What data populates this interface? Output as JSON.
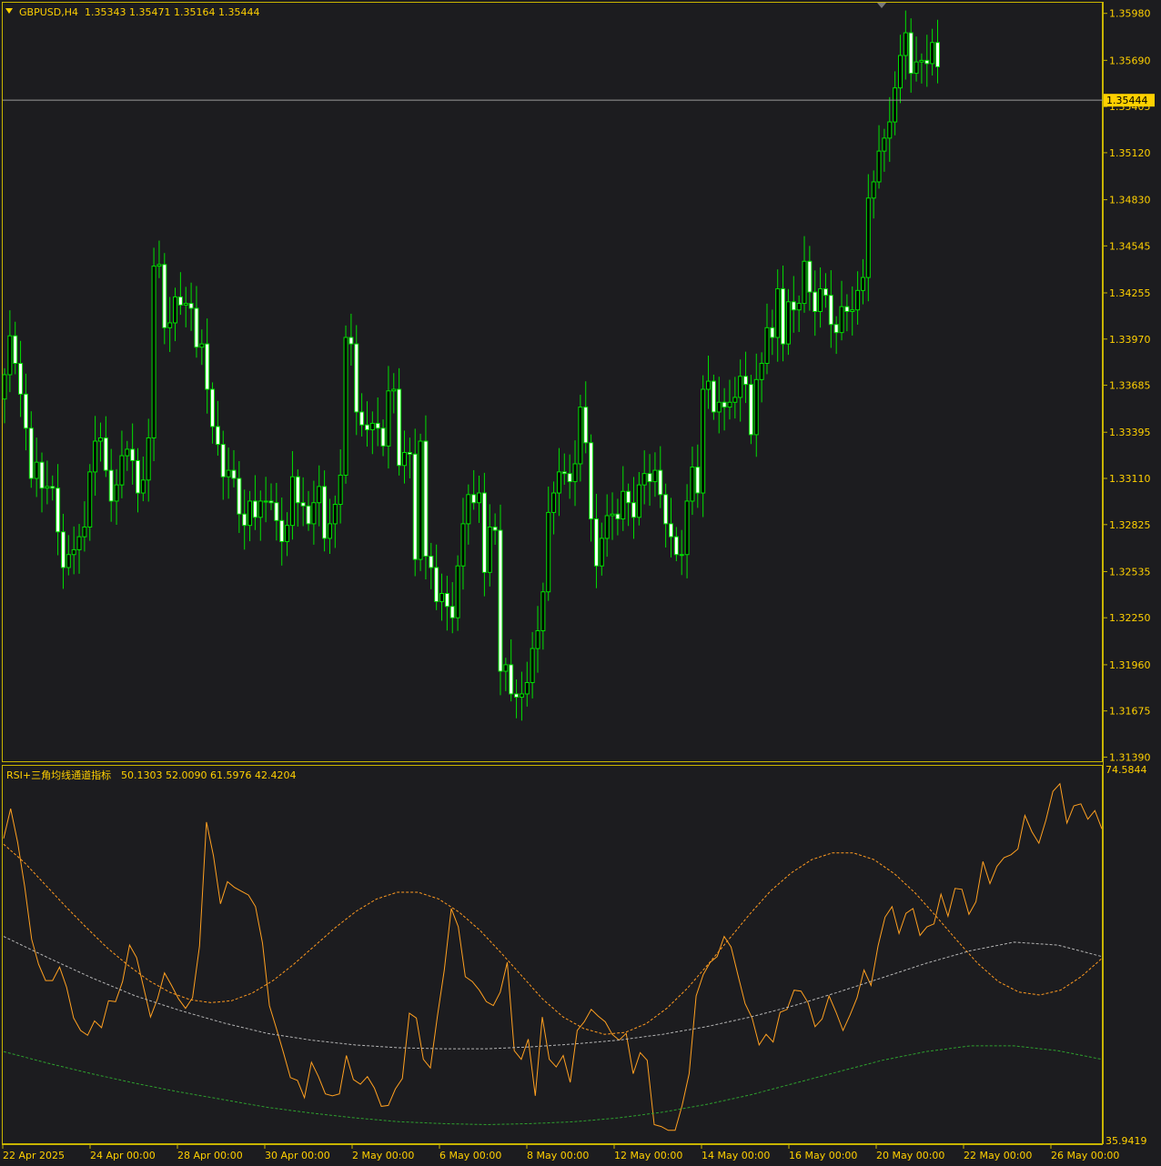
{
  "header": {
    "symbol": "GBPUSD,H4",
    "ohlc": "1.35343 1.35471 1.35164 1.35444"
  },
  "indicator_header": {
    "name": "RSI+三角均线通道指标",
    "values": "50.1303 52.0090 61.5976 42.4204"
  },
  "colors": {
    "background": "#1c1c1f",
    "frame": "#c8b400",
    "candle": "#00e000",
    "bull_fill": "#000000",
    "bear_fill": "#ffffff",
    "text": "#ffd000",
    "rsi": "#ffa020",
    "upper_band": "#ff9a20",
    "mid_band": "#b4b4b4",
    "lower_band": "#2ea02e",
    "price_line": "#9a9a9a",
    "price_tag_bg": "#ffd000"
  },
  "chart_data": [
    {
      "type": "candlestick",
      "symbol": "GBPUSD",
      "timeframe": "H4",
      "y_ticks": [
        1.3598,
        1.3569,
        1.35405,
        1.3512,
        1.3483,
        1.34545,
        1.34255,
        1.3397,
        1.33685,
        1.33395,
        1.3311,
        1.32825,
        1.32535,
        1.3225,
        1.3196,
        1.31675,
        1.3139
      ],
      "y_tick_labels": [
        "1.35980",
        "1.35690",
        "1.35405",
        "1.35120",
        "1.34830",
        "1.34545",
        "1.34255",
        "1.33970",
        "1.33685",
        "1.33395",
        "1.33110",
        "1.32825",
        "1.32535",
        "1.32250",
        "1.31960",
        "1.31675",
        "1.31390"
      ],
      "ylim": [
        1.3137,
        1.3604
      ],
      "current_price": 1.35444,
      "current_price_label": "1.35444",
      "x_labels": [
        "22 Apr 2025",
        "24 Apr 00:00",
        "28 Apr 00:00",
        "30 Apr 00:00",
        "2 May 00:00",
        "6 May 00:00",
        "8 May 00:00",
        "12 May 00:00",
        "14 May 00:00",
        "16 May 00:00",
        "20 May 00:00",
        "22 May 00:00",
        "26 May 00:00"
      ],
      "close": [
        1.3375,
        1.3399,
        1.3382,
        1.3363,
        1.3342,
        1.3311,
        1.3321,
        1.3305,
        1.3306,
        1.3305,
        1.3278,
        1.3256,
        1.3264,
        1.3267,
        1.3275,
        1.3281,
        1.3315,
        1.3334,
        1.3336,
        1.3316,
        1.3297,
        1.3307,
        1.3325,
        1.3329,
        1.3322,
        1.3302,
        1.331,
        1.3336,
        1.3442,
        1.3443,
        1.3404,
        1.3407,
        1.3423,
        1.3418,
        1.3419,
        1.3416,
        1.3392,
        1.3394,
        1.3366,
        1.3343,
        1.3332,
        1.3312,
        1.3316,
        1.3311,
        1.3289,
        1.3282,
        1.3297,
        1.3287,
        1.3297,
        1.3297,
        1.3296,
        1.3285,
        1.3272,
        1.3282,
        1.3312,
        1.3296,
        1.3294,
        1.3283,
        1.3296,
        1.3306,
        1.3274,
        1.3283,
        1.3295,
        1.3313,
        1.3398,
        1.3394,
        1.3352,
        1.3344,
        1.3341,
        1.3345,
        1.3342,
        1.3331,
        1.3365,
        1.3366,
        1.3319,
        1.3327,
        1.3326,
        1.3261,
        1.3334,
        1.3263,
        1.3256,
        1.3235,
        1.324,
        1.3232,
        1.3225,
        1.3257,
        1.3283,
        1.3301,
        1.3296,
        1.3302,
        1.3253,
        1.3281,
        1.3279,
        1.3192,
        1.3196,
        1.3178,
        1.3176,
        1.3178,
        1.3185,
        1.3206,
        1.3217,
        1.3241,
        1.329,
        1.3302,
        1.3315,
        1.3314,
        1.3309,
        1.332,
        1.3355,
        1.3333,
        1.3286,
        1.3257,
        1.3274,
        1.3288,
        1.3289,
        1.3286,
        1.3303,
        1.3296,
        1.3287,
        1.3307,
        1.3314,
        1.3309,
        1.3316,
        1.3301,
        1.3283,
        1.3275,
        1.3264,
        1.3264,
        1.3297,
        1.3318,
        1.3302,
        1.3366,
        1.3371,
        1.3352,
        1.3358,
        1.3355,
        1.3358,
        1.3361,
        1.3374,
        1.3369,
        1.3338,
        1.3372,
        1.3382,
        1.3404,
        1.3398,
        1.3428,
        1.3394,
        1.342,
        1.3415,
        1.3419,
        1.3445,
        1.3426,
        1.3414,
        1.3428,
        1.3424,
        1.3406,
        1.3401,
        1.3417,
        1.3414,
        1.3415,
        1.3427,
        1.3435,
        1.3484,
        1.3494,
        1.3513,
        1.3521,
        1.3531,
        1.3552,
        1.3572,
        1.3586,
        1.3561,
        1.3568,
        1.3569,
        1.3567,
        1.358,
        1.3565
      ]
    },
    {
      "type": "line",
      "title": "RSI+三角均线通道指标",
      "ylim": [
        35.9419,
        74.5844
      ],
      "y_tick_labels": [
        "74.5844",
        "35.9419"
      ],
      "series": [
        {
          "values": [
            67.4,
            70.5,
            67.0,
            62.4,
            56.9,
            54.3,
            52.6,
            52.6,
            54.0,
            51.9,
            48.7,
            47.4,
            46.9,
            48.4,
            47.7,
            50.5,
            50.4,
            52.5,
            56.3,
            55.0,
            51.9,
            48.8,
            50.7,
            53.4,
            52.1,
            50.7,
            49.7,
            50.8,
            56.2,
            69.1,
            65.6,
            60.6,
            62.9,
            62.3,
            61.9,
            61.5,
            60.3,
            56.5,
            50.0,
            47.6,
            45.1,
            42.5,
            42.2,
            40.4,
            44.1,
            42.6,
            40.8,
            40.6,
            40.8,
            44.8,
            42.3,
            41.8,
            42.6,
            41.4,
            39.5,
            39.6,
            41.3,
            42.4,
            49.2,
            48.7,
            44.4,
            43.5,
            48.8,
            53.7,
            60.1,
            58.2,
            53.0,
            52.5,
            51.6,
            50.4,
            50.0,
            51.4,
            54.5,
            45.3,
            44.4,
            46.5,
            40.6,
            48.8,
            44.4,
            43.6,
            44.8,
            42.0,
            47.4,
            48.3,
            49.6,
            48.9,
            48.3,
            47.0,
            46.4,
            47.1,
            42.9,
            45.1,
            44.3,
            37.6,
            37.4,
            37.0,
            37.0,
            39.6,
            42.9,
            51.0,
            53.2,
            54.5,
            55.1,
            57.2,
            56.1,
            53.1,
            50.2,
            48.7,
            45.9,
            47.0,
            46.2,
            49.3,
            49.6,
            51.6,
            51.5,
            50.3,
            47.8,
            48.6,
            51.0,
            49.3,
            47.4,
            49.0,
            50.8,
            53.7,
            52.1,
            56.2,
            59.2,
            60.3,
            57.5,
            59.6,
            60.1,
            57.3,
            58.2,
            58.5,
            61.6,
            59.3,
            62.2,
            62.1,
            59.5,
            60.8,
            65.0,
            62.7,
            64.5,
            65.4,
            65.7,
            66.3,
            69.8,
            68.1,
            66.9,
            69.3,
            72.3,
            73.1,
            69.0,
            70.8,
            71.0,
            69.4,
            70.3,
            68.4
          ]
        },
        {
          "values": [
            66.8,
            64.9,
            62.6,
            60.3,
            58.1,
            56.0,
            54.2,
            52.6,
            51.4,
            50.6,
            50.3,
            50.5,
            51.3,
            52.6,
            54.3,
            56.2,
            58.1,
            59.8,
            61.1,
            61.8,
            61.8,
            61.1,
            59.7,
            57.8,
            55.5,
            53.1,
            50.7,
            48.8,
            47.6,
            47.0,
            47.2,
            48.1,
            49.7,
            51.8,
            54.3,
            56.9,
            59.5,
            61.9,
            63.8,
            65.2,
            65.9,
            65.9,
            65.2,
            63.7,
            61.7,
            59.3,
            56.8,
            54.4,
            52.5,
            51.4,
            51.1,
            51.6,
            53.0,
            54.9
          ]
        },
        {
          "values": [
            57.2,
            55.0,
            52.9,
            51.0,
            49.5,
            48.2,
            47.1,
            46.4,
            45.9,
            45.6,
            45.5,
            45.5,
            45.7,
            46.0,
            46.4,
            47.0,
            47.8,
            48.8,
            50.0,
            51.4,
            52.9,
            54.4,
            55.7,
            56.6,
            56.3,
            55.1
          ]
        },
        {
          "values": [
            45.2,
            44.0,
            42.9,
            41.9,
            41.0,
            40.2,
            39.4,
            38.8,
            38.3,
            37.9,
            37.7,
            37.6,
            37.7,
            37.9,
            38.3,
            38.9,
            39.7,
            40.7,
            41.9,
            43.1,
            44.3,
            45.2,
            45.8,
            45.8,
            45.3,
            44.4
          ]
        }
      ]
    }
  ]
}
